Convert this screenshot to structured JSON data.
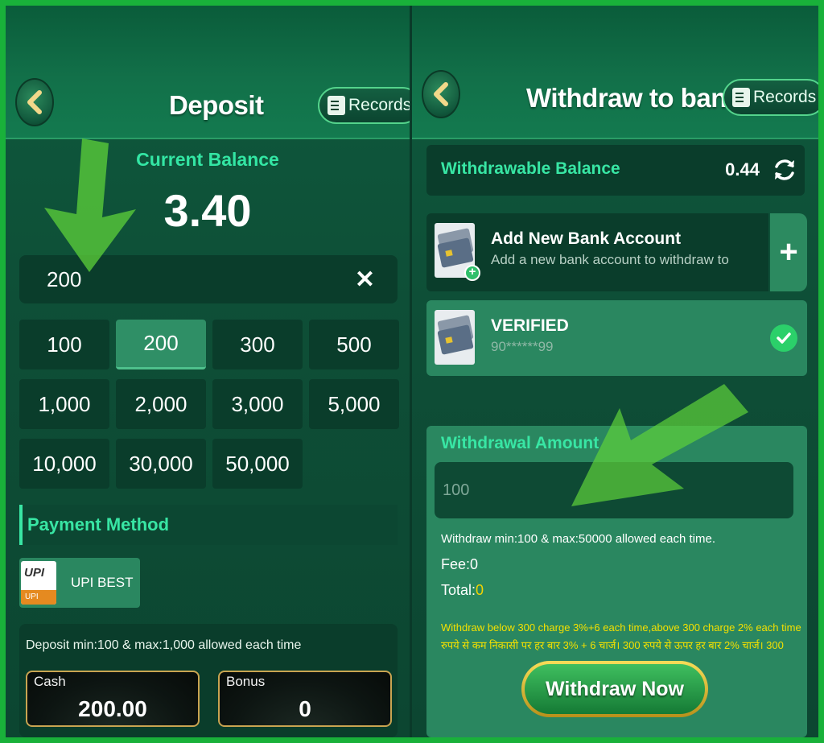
{
  "deposit": {
    "title": "Deposit",
    "records_label": "Records",
    "current_balance_label": "Current Balance",
    "current_balance": "3.40",
    "amount_value": "200",
    "amount_chips": [
      "100",
      "200",
      "300",
      "500",
      "1,000",
      "2,000",
      "3,000",
      "5,000",
      "10,000",
      "30,000",
      "50,000"
    ],
    "selected_chip": "200",
    "payment_method_label": "Payment Method",
    "upi_label": "UPI BEST",
    "upi_logo_text": "UPI",
    "deposit_rule": "Deposit min:100 & max:1,000 allowed each time",
    "cash_label": "Cash",
    "cash_value": "200.00",
    "bonus_label": "Bonus",
    "bonus_value": "0"
  },
  "withdraw": {
    "title": "Withdraw to bank",
    "records_label": "Records",
    "withdrawable_label": "Withdrawable Balance",
    "withdrawable_value": "0.44",
    "add_account_title": "Add New Bank Account",
    "add_account_sub": "Add a new bank account to withdraw to",
    "verified_title": "VERIFIED",
    "verified_account": "90******99",
    "amount_label": "Withdrawal Amount",
    "amount_placeholder": "100",
    "rule": "Withdraw min:100 & max:50000 allowed each time.",
    "fee_label": "Fee:",
    "fee_value": "0",
    "total_label": "Total:",
    "total_value": "0",
    "charge_en": "Withdraw below 300 charge 3%+6 each time,above 300 charge 2% each time",
    "charge_hi": "रुपये से कम निकासी पर हर बार 3% + 6 चार्ज। 300 रुपये से ऊपर हर बार 2% चार्ज। 300",
    "button_label": "Withdraw Now"
  },
  "colors": {
    "frame": "#19b13a",
    "accent_text": "#38e6a4",
    "panel_dark": "#0a3d2b",
    "panel_light": "#2a8760",
    "warning_text": "#f3e000",
    "arrow": "#5ed23a"
  },
  "icons": [
    "chevron-left-icon",
    "records-icon",
    "close-icon",
    "refresh-icon",
    "plus-icon",
    "check-icon",
    "bank-card-icon",
    "upi-logo",
    "green-arrow-icon"
  ]
}
